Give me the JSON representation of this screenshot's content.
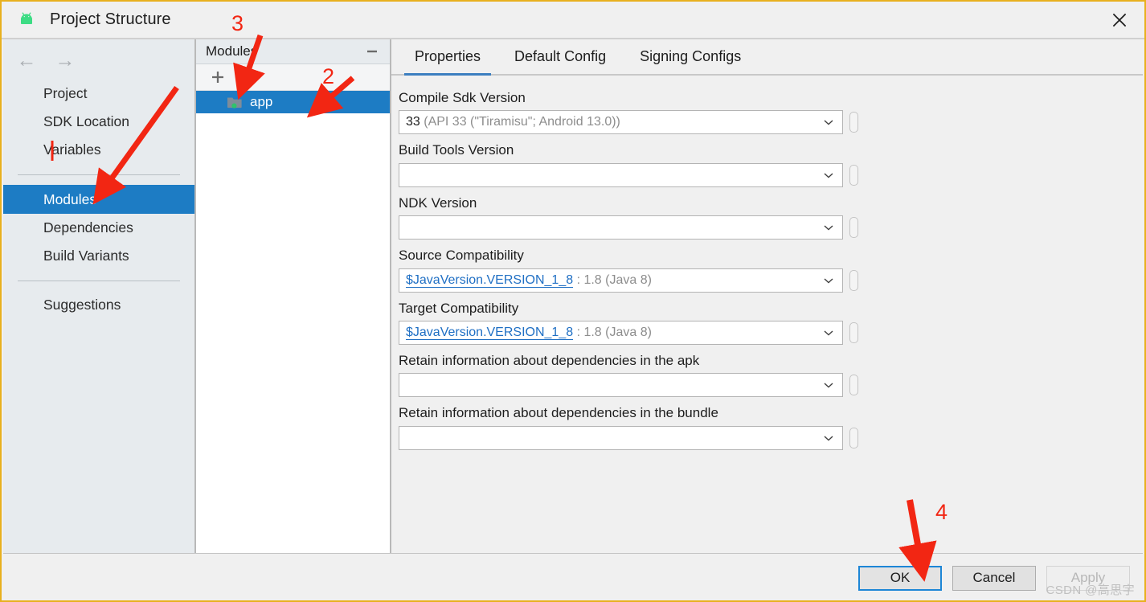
{
  "window": {
    "title": "Project Structure",
    "app_icon": "android-robot-icon",
    "close_icon": "close-icon",
    "border_color": "#e8b01e"
  },
  "sidebar": {
    "nav": {
      "back_icon": "arrow-left-icon",
      "forward_icon": "arrow-right-icon"
    },
    "items": [
      {
        "label": "Project",
        "selected": false
      },
      {
        "label": "SDK Location",
        "selected": false
      },
      {
        "label": "Variables",
        "selected": false
      },
      {
        "label": "Modules",
        "selected": true
      },
      {
        "label": "Dependencies",
        "selected": false
      },
      {
        "label": "Build Variants",
        "selected": false
      },
      {
        "label": "Suggestions",
        "selected": false
      }
    ]
  },
  "modules_panel": {
    "title": "Modules",
    "collapse_icon": "minimize-icon",
    "toolbar": {
      "add_label": "+",
      "add_icon": "plus-icon",
      "remove_label": "–",
      "remove_icon": "minus-icon"
    },
    "modules": [
      {
        "name": "app",
        "icon": "folder-icon",
        "selected": true
      }
    ]
  },
  "content": {
    "tabs": [
      {
        "label": "Properties",
        "active": true
      },
      {
        "label": "Default Config",
        "active": false
      },
      {
        "label": "Signing Configs",
        "active": false
      }
    ],
    "fields": [
      {
        "label": "Compile Sdk Version",
        "value_main": "33",
        "value_suffix": " (API 33 (\"Tiramisu\"; Android 13.0))",
        "style": "dark",
        "has_variable_button": true
      },
      {
        "label": "Build Tools Version",
        "value_main": "",
        "value_suffix": "",
        "style": "dark",
        "has_variable_button": true
      },
      {
        "label": "NDK Version",
        "value_main": "",
        "value_suffix": "",
        "style": "dark",
        "has_variable_button": true
      },
      {
        "label": "Source Compatibility",
        "value_main": "$JavaVersion.VERSION_1_8",
        "value_suffix": " : 1.8 (Java 8)",
        "style": "link",
        "has_variable_button": true
      },
      {
        "label": "Target Compatibility",
        "value_main": "$JavaVersion.VERSION_1_8",
        "value_suffix": " : 1.8 (Java 8)",
        "style": "link",
        "has_variable_button": true
      },
      {
        "label": "Retain information about dependencies in the apk",
        "value_main": "",
        "value_suffix": "",
        "style": "dark",
        "has_variable_button": true
      },
      {
        "label": "Retain information about dependencies in the bundle",
        "value_main": "",
        "value_suffix": "",
        "style": "dark",
        "has_variable_button": true
      }
    ]
  },
  "buttons": {
    "ok": "OK",
    "cancel": "Cancel",
    "apply": "Apply"
  },
  "watermark": "CSDN @高思宇",
  "annotations": [
    {
      "id": "1",
      "label": "1"
    },
    {
      "id": "2",
      "label": "2"
    },
    {
      "id": "3",
      "label": "3"
    },
    {
      "id": "4",
      "label": "4"
    }
  ]
}
